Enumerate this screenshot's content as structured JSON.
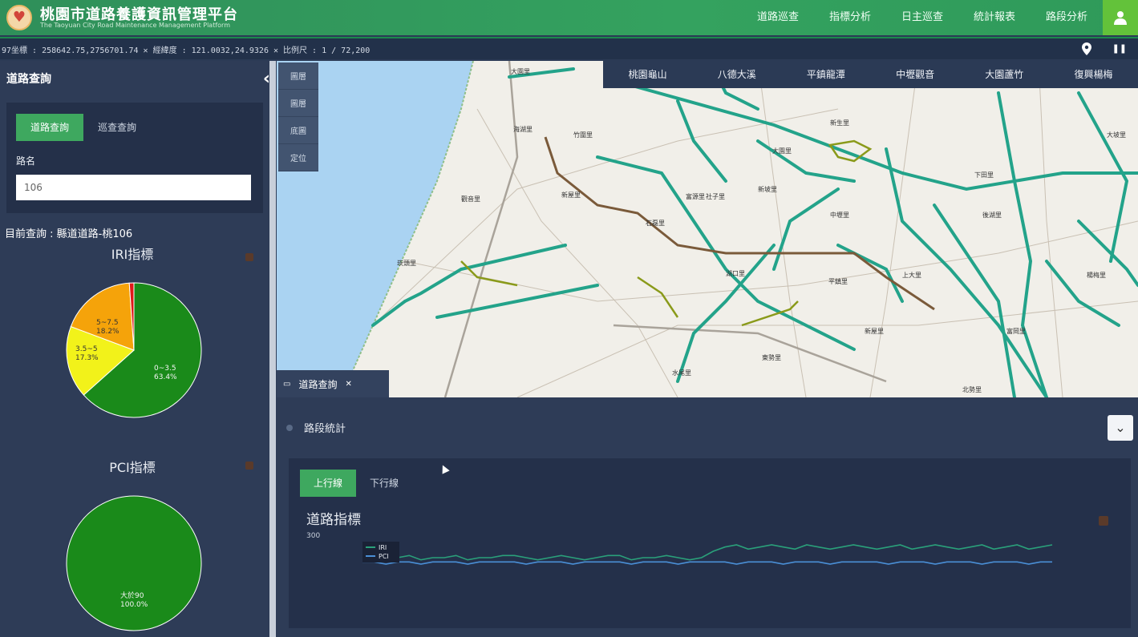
{
  "header": {
    "title": "桃園市道路養護資訊管理平台",
    "subtitle": "The Taoyuan City Road Maintenance Management Platform",
    "nav": [
      "道路巡查",
      "指標分析",
      "日主巡查",
      "統計報表",
      "路段分析"
    ],
    "user_icon": "user-icon"
  },
  "statusbar": {
    "text": "97坐標 : 258642.75,2756701.74 ✕ 經緯度 : 121.0032,24.9326 ✕ 比例尺 : 1 / 72,200"
  },
  "sidebar": {
    "title": "道路查詢",
    "query_tabs": [
      "道路查詢",
      "巡查查詢"
    ],
    "field_label": "路名",
    "road_value": "106",
    "current_query": "目前查詢 : 縣道道路-桃106",
    "iri_title": "IRI指標",
    "pci_title": "PCI指標",
    "iri_slices": [
      {
        "label": "0~3.5",
        "percent": 63.4,
        "color": "#1a8a1a"
      },
      {
        "label": "3.5~5",
        "percent": 17.3,
        "color": "#f2f21a"
      },
      {
        "label": "5~7.5",
        "percent": 18.2,
        "color": "#f5a30a"
      },
      {
        "label": ">7.5",
        "percent": 1.1,
        "color": "#e01818"
      }
    ],
    "iri_texts": {
      "a": "0~3.5",
      "a_pct": "63.4%",
      "b": "3.5~5",
      "b_pct": "17.3%",
      "c": "5~7.5",
      "c_pct": "18.2%"
    },
    "pci_slices": [
      {
        "label": "大於90",
        "percent": 100.0,
        "color": "#1a8a1a"
      }
    ],
    "pci_texts": {
      "a": "大於90",
      "a_pct": "100.0%"
    }
  },
  "map": {
    "regions": [
      "桃園龜山",
      "八德大溪",
      "平鎮龍潭",
      "中壢觀音",
      "大園蘆竹",
      "復興楊梅"
    ],
    "tools": [
      "圖層",
      "圖層",
      "底圖",
      "定位"
    ],
    "towns": [
      "大園里",
      "新生里",
      "竹圍里",
      "海湖里",
      "大園里",
      "觀音里",
      "富源里",
      "新坡里",
      "上大里",
      "新屋里",
      "石磊里",
      "中壢里",
      "後湖里",
      "崁頭里",
      "湖口里",
      "平鎮里",
      "楊梅里",
      "富岡里",
      "東勢里",
      "新屋里",
      "水尾里",
      "北勢里",
      "大坡里",
      "下田里",
      "社子里"
    ]
  },
  "lower": {
    "tab_label": "道路查詢",
    "section_label": "路段統計",
    "chart_tabs": [
      "上行線",
      "下行線"
    ],
    "chart_title": "道路指標"
  },
  "chart_data": {
    "type": "line",
    "title": "道路指標",
    "ylabel": "300",
    "series": [
      {
        "name": "IRI",
        "color": "#2aa07a",
        "values": [
          2.1,
          2.2,
          2.0,
          2.1,
          2.2,
          2.0,
          2.1,
          2.1,
          2.2,
          2.0,
          2.1,
          2.1,
          2.2,
          2.2,
          2.1,
          2.0,
          2.1,
          2.2,
          2.1,
          2.0,
          2.1,
          2.2,
          2.2,
          2.0,
          2.1,
          2.1,
          2.2,
          2.1,
          2.0,
          2.1,
          2.4,
          2.6,
          2.7,
          2.5,
          2.6,
          2.7,
          2.6,
          2.5,
          2.7,
          2.6,
          2.5,
          2.6,
          2.7,
          2.6,
          2.5,
          2.6,
          2.7,
          2.5,
          2.6,
          2.7,
          2.6,
          2.5,
          2.6,
          2.7,
          2.5,
          2.6,
          2.7,
          2.5,
          2.6,
          2.7
        ]
      },
      {
        "name": "PCI",
        "color": "#4a8fd6",
        "values": [
          1.9,
          1.9,
          1.8,
          1.9,
          1.9,
          1.8,
          1.9,
          1.9,
          1.9,
          1.8,
          1.9,
          1.9,
          1.9,
          1.9,
          1.8,
          1.9,
          1.9,
          1.9,
          1.8,
          1.9,
          1.9,
          1.9,
          1.9,
          1.8,
          1.9,
          1.9,
          1.9,
          1.8,
          1.9,
          1.9,
          1.9,
          1.9,
          1.8,
          1.9,
          1.9,
          1.9,
          1.8,
          1.9,
          1.9,
          1.9,
          1.8,
          1.9,
          1.9,
          1.9,
          1.9,
          1.8,
          1.9,
          1.9,
          1.9,
          1.8,
          1.9,
          1.9,
          1.9,
          1.8,
          1.9,
          1.9,
          1.9,
          1.8,
          1.9,
          1.9
        ]
      }
    ]
  }
}
